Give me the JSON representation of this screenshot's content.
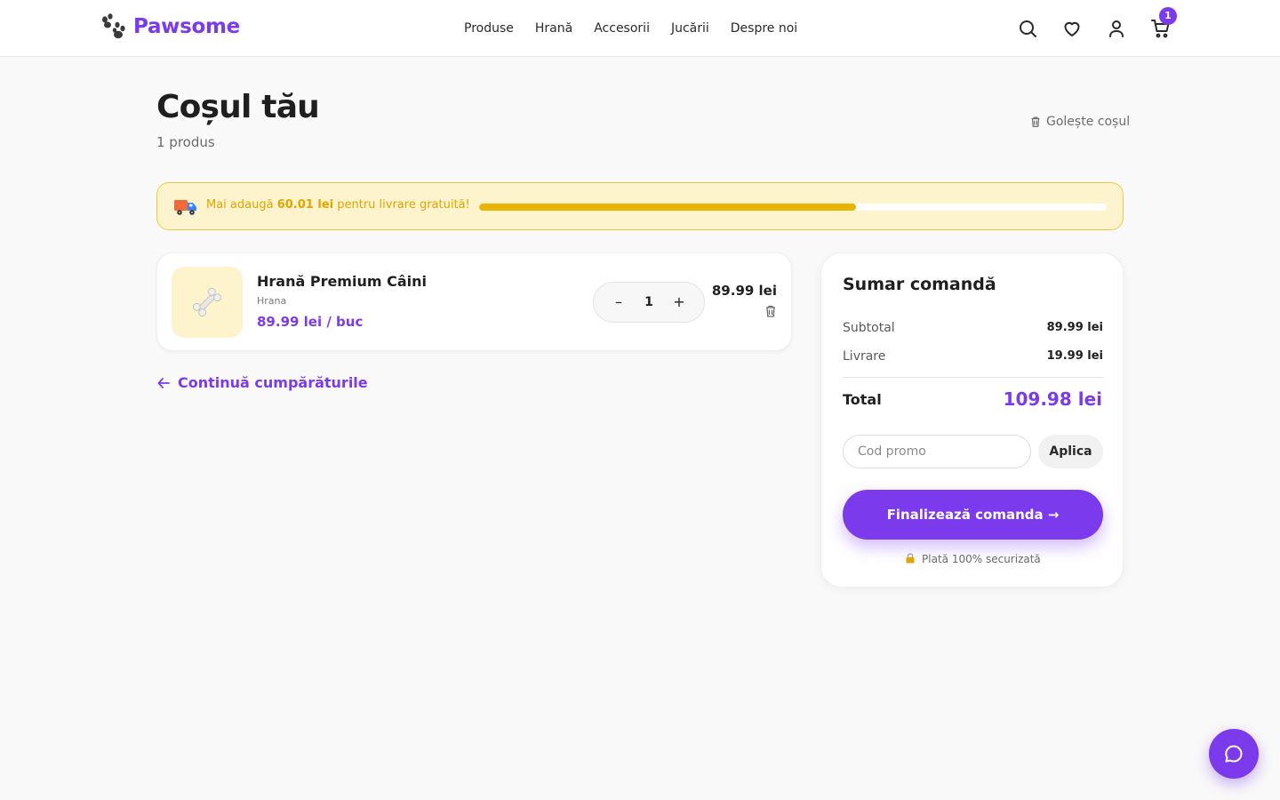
{
  "brand": {
    "name": "Pawsome",
    "accent": "#7c3aed"
  },
  "nav": {
    "items": [
      "Produse",
      "Hrană",
      "Accesorii",
      "Jucării",
      "Despre noi"
    ]
  },
  "header": {
    "icons": [
      "search-icon",
      "heart-icon",
      "user-icon",
      "cart-icon"
    ],
    "cart_count": "1"
  },
  "page": {
    "title": "Coșul tău",
    "subtitle": "1 produs",
    "clear_label": "Golește coșul"
  },
  "shipping": {
    "prefix": "Mai adaugă",
    "amount": "60.01 lei",
    "suffix": "pentru livrare gratuită!",
    "progress_fraction": 0.6,
    "color": "#eab308"
  },
  "cart": {
    "items": [
      {
        "name": "Hrană Premium Câini",
        "category": "Hrana",
        "unit_price": "89.99 lei / buc",
        "quantity": "1",
        "total": "89.99 lei",
        "icon": "bone-icon"
      }
    ],
    "minus_label": "–",
    "plus_label": "+"
  },
  "continue_label": "Continuă cumpărăturile",
  "summary": {
    "title": "Sumar comandă",
    "subtotal_label": "Subtotal",
    "subtotal_value": "89.99 lei",
    "shipping_label": "Livrare",
    "shipping_value": "19.99 lei",
    "total_label": "Total",
    "total_value": "109.98 lei",
    "promo_placeholder": "Cod promo",
    "promo_button": "Aplica",
    "checkout_button": "Finalizează comanda →",
    "secure_text": "Plată 100% securizată"
  }
}
